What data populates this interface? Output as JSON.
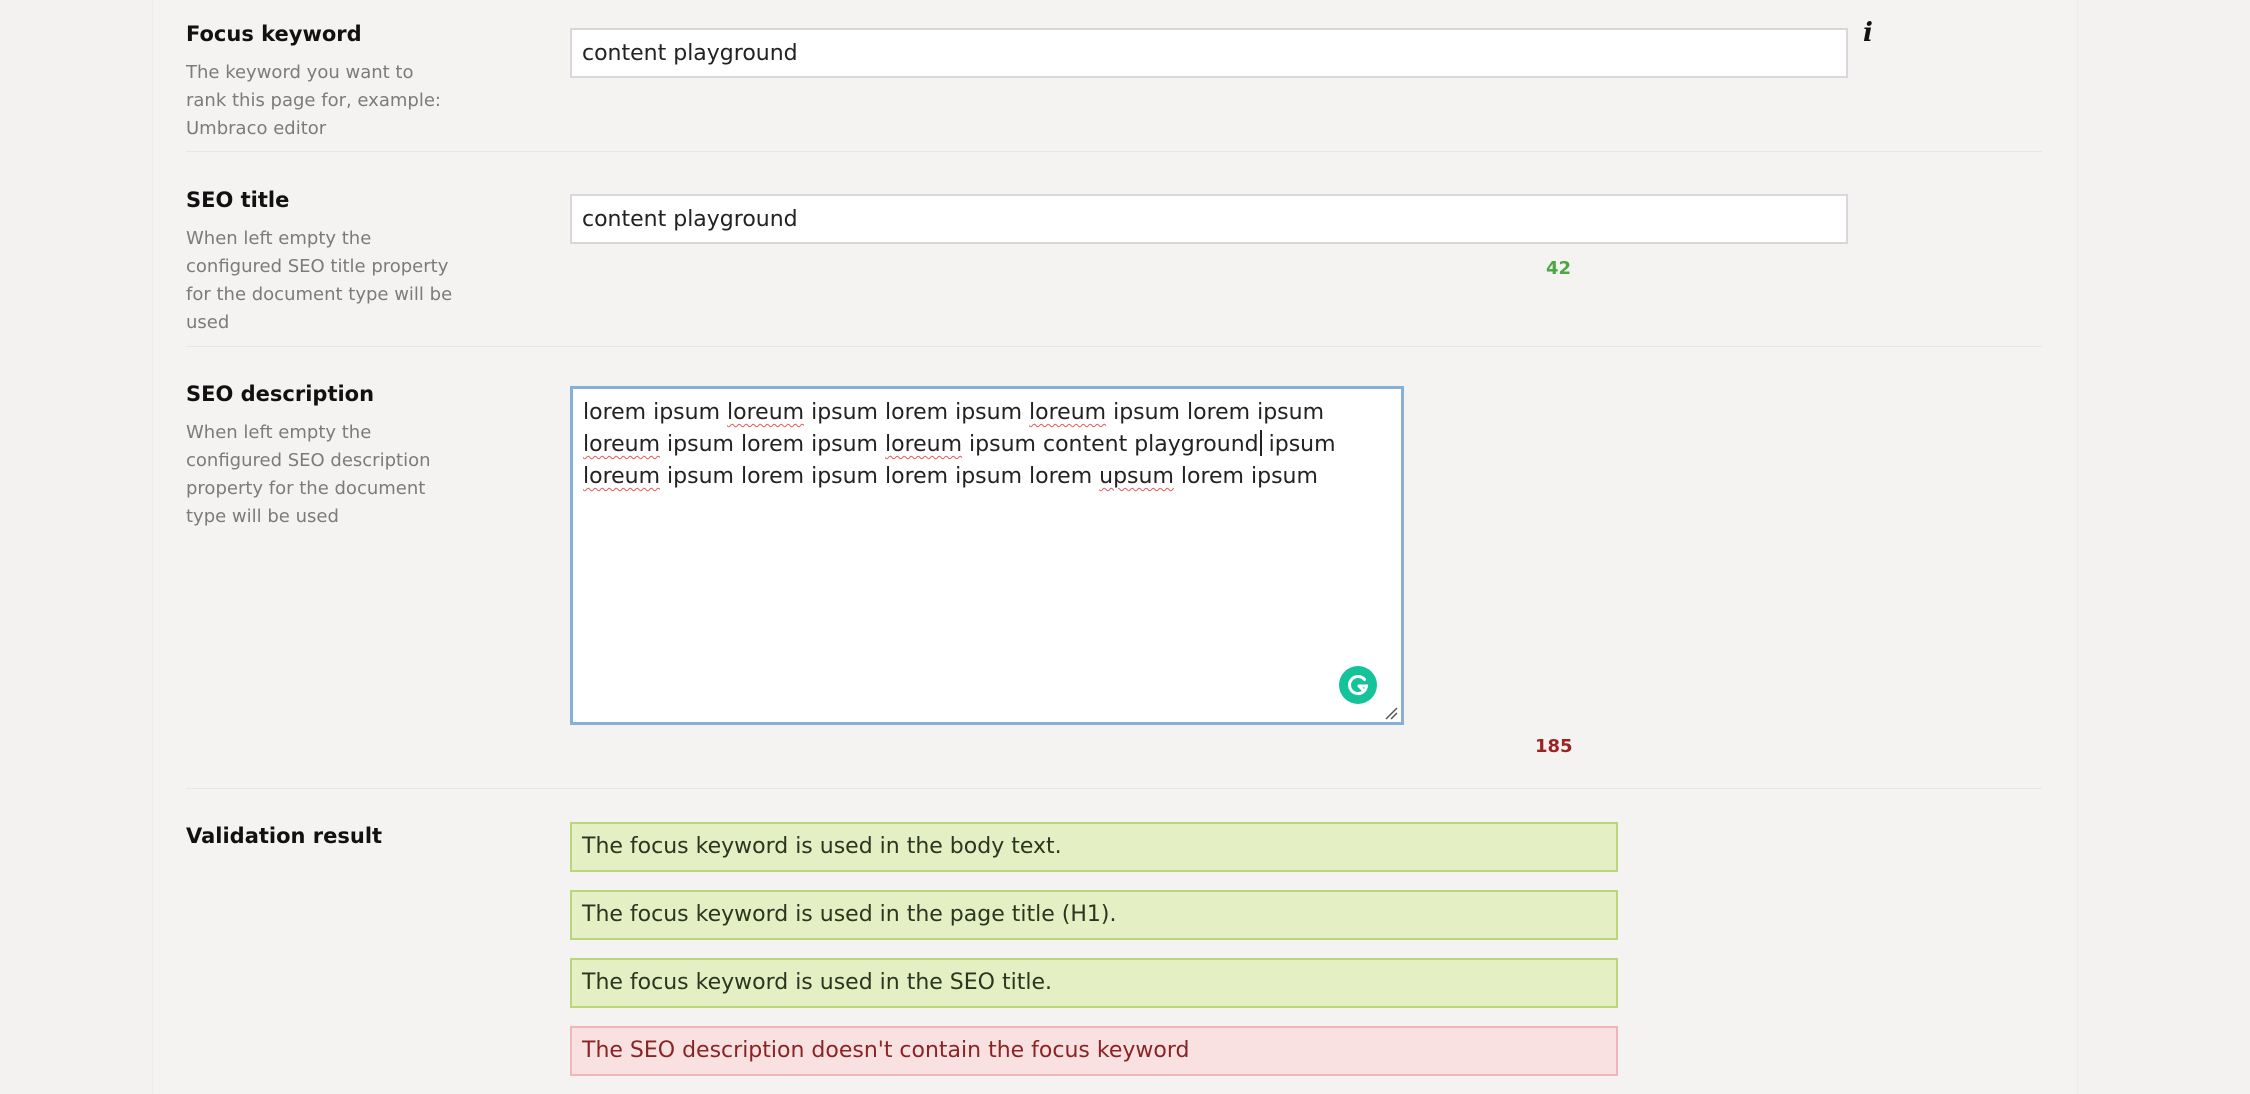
{
  "focus_keyword": {
    "label": "Focus keyword",
    "description": "The keyword you want to rank this page for, example: Umbraco editor",
    "value": "content playground"
  },
  "seo_title": {
    "label": "SEO title",
    "description": "When left empty the configured SEO title property for the document type will be used",
    "value": "content playground",
    "char_count": "42",
    "count_color": "#4aa741"
  },
  "seo_description": {
    "label": "SEO description",
    "description": "When left empty the configured SEO description property for the document type will be used",
    "value": "lorem ipsum loreum ipsum lorem ipsum loreum ipsum lorem ipsum loreum ipsum lorem ipsum loreum ipsum content playground ipsum loreum ipsum lorem ipsum lorem ipsum lorem upsum lorem ipsum",
    "char_count": "185",
    "count_color": "#9a2422"
  },
  "validation": {
    "label": "Validation result",
    "results": [
      {
        "text": "The focus keyword is used in the body text.",
        "status": "pass"
      },
      {
        "text": "The focus keyword is used in the page title (H1).",
        "status": "pass"
      },
      {
        "text": "The focus keyword is used in the SEO title.",
        "status": "pass"
      },
      {
        "text": "The SEO description doesn't contain the focus keyword",
        "status": "fail"
      }
    ]
  },
  "icons": {
    "info": "info-icon",
    "grammarly": "grammarly-icon",
    "resize": "resize-handle-icon"
  },
  "colors": {
    "pass_bg": "#e5efc4",
    "fail_bg": "#f9e1e1",
    "focus_border": "#86b0d6"
  }
}
